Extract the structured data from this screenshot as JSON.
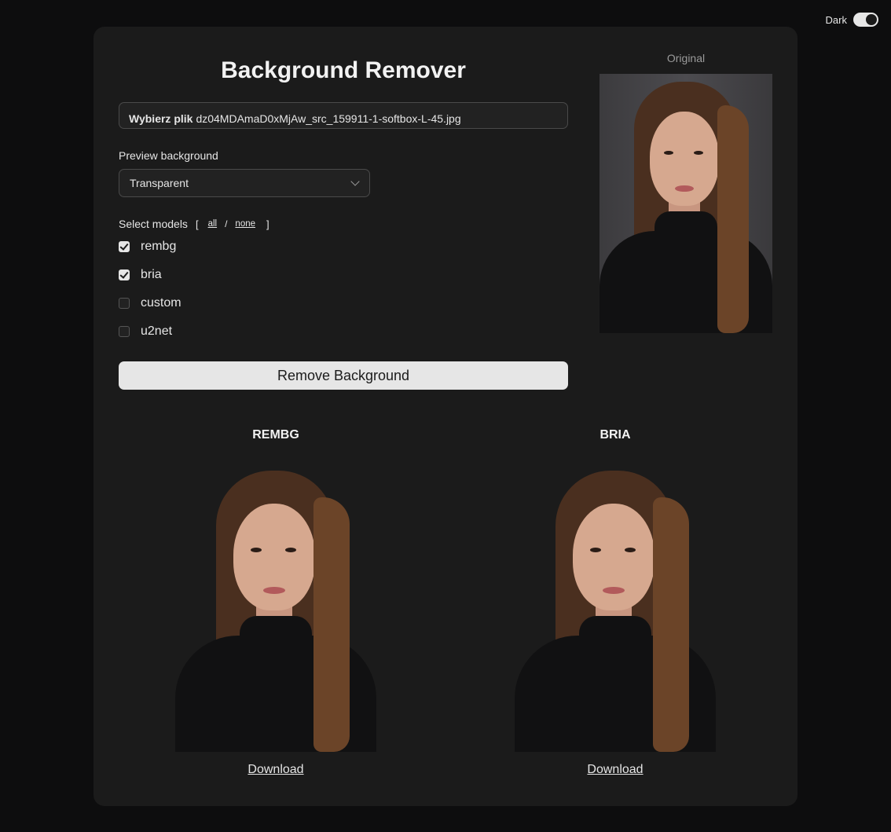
{
  "theme": {
    "label": "Dark",
    "enabled": true
  },
  "app": {
    "title": "Background Remover"
  },
  "file": {
    "button_label": "Wybierz plik",
    "filename": "dz04MDAmaD0xMjAw_src_159911-1-softbox-L-45.jpg"
  },
  "preview_background": {
    "label": "Preview background",
    "selected": "Transparent"
  },
  "models": {
    "label": "Select models",
    "bracket_open": "[",
    "bracket_close": "]",
    "separator": "/",
    "all_label": "all",
    "none_label": "none",
    "items": [
      {
        "name": "rembg",
        "checked": true
      },
      {
        "name": "bria",
        "checked": true
      },
      {
        "name": "custom",
        "checked": false
      },
      {
        "name": "u2net",
        "checked": false
      }
    ]
  },
  "remove_button": {
    "label": "Remove Background"
  },
  "original": {
    "label": "Original"
  },
  "results": [
    {
      "label": "REMBG",
      "download_label": "Download"
    },
    {
      "label": "BRIA",
      "download_label": "Download"
    }
  ],
  "colors": {
    "page_bg": "#0d0d0e",
    "card_bg": "#1b1b1b",
    "button_bg": "#e6e6e6",
    "text": "#e6e6e6"
  }
}
